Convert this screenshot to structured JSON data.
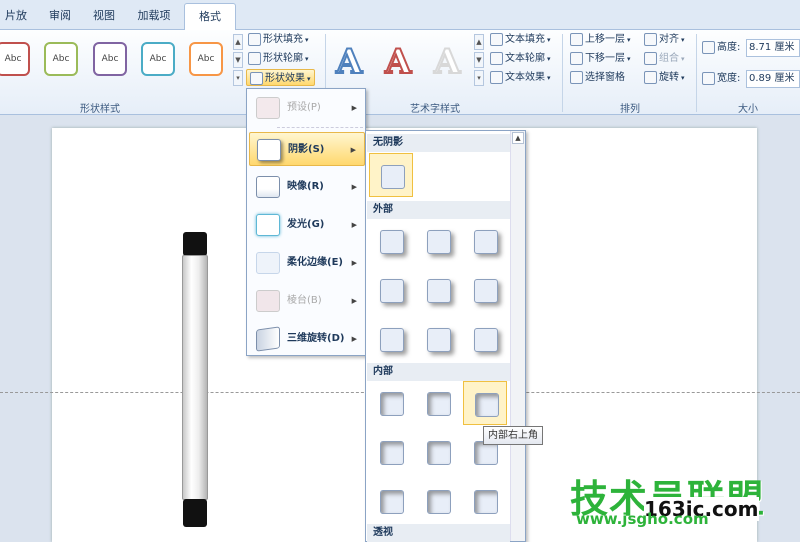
{
  "tabs": [
    {
      "label": "片放映"
    },
    {
      "label": "审阅"
    },
    {
      "label": "视图"
    },
    {
      "label": "加载项"
    },
    {
      "label": "格式"
    }
  ],
  "ribbon": {
    "shape_styles": {
      "swatches": [
        {
          "text": "Abc",
          "color": "#c0504d"
        },
        {
          "text": "Abc",
          "color": "#9bbb59"
        },
        {
          "text": "Abc",
          "color": "#8064a2"
        },
        {
          "text": "Abc",
          "color": "#4bacc6"
        },
        {
          "text": "Abc",
          "color": "#f79646"
        }
      ],
      "fill": "形状填充",
      "outline": "形状轮廓",
      "effects": "形状效果",
      "label": "形状样式"
    },
    "wordart": {
      "letters": [
        {
          "text": "A",
          "color": "#4f81bd"
        },
        {
          "text": "A",
          "color": "#c0504d"
        },
        {
          "text": "A",
          "color": "#d8d8d8"
        }
      ],
      "text_fill": "文本填充",
      "text_outline": "文本轮廓",
      "text_effects": "文本效果",
      "label": "艺术字样式"
    },
    "arrange": {
      "bring_forward": "上移一层",
      "send_backward": "下移一层",
      "selection_pane": "选择窗格",
      "align": "对齐",
      "group": "组合",
      "rotate": "旋转",
      "label": "排列"
    },
    "size": {
      "height_label": "高度:",
      "height_value": "8.71 厘米",
      "width_label": "宽度:",
      "width_value": "0.89 厘米",
      "label": "大小"
    }
  },
  "effects_menu": {
    "items": [
      {
        "label": "预设(P)",
        "enabled": false
      },
      {
        "label": "阴影(S)",
        "enabled": true
      },
      {
        "label": "映像(R)",
        "enabled": true
      },
      {
        "label": "发光(G)",
        "enabled": true
      },
      {
        "label": "柔化边缘(E)",
        "enabled": true
      },
      {
        "label": "棱台(B)",
        "enabled": false
      },
      {
        "label": "三维旋转(D)",
        "enabled": true
      }
    ]
  },
  "shadow_submenu": {
    "no_shadow": "无阴影",
    "outer": "外部",
    "inner": "内部",
    "perspective": "透视"
  },
  "tooltip": "内部右上角",
  "watermark": {
    "main": "技术员联盟",
    "site": "163ic.com",
    "url": "www.jsgho.com"
  }
}
